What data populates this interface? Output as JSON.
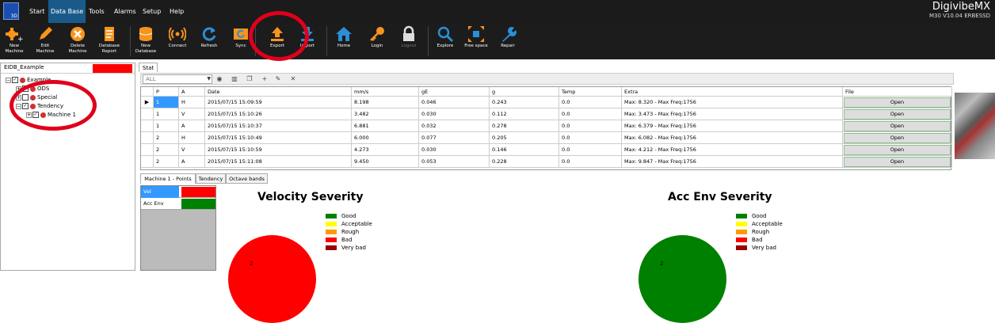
{
  "app": {
    "logo_text": "3D",
    "brand_name": "DigivibeMX",
    "brand_sub": "M30 V10.04",
    "brand_tag": "ERBESSD"
  },
  "menu": [
    "Start",
    "Data Base",
    "Tools",
    "Alarms",
    "Setup",
    "Help"
  ],
  "ribbon": [
    {
      "label": "New Machine",
      "icon": "new-machine-icon",
      "enabled": true
    },
    {
      "label": "Edit Machine",
      "icon": "pencil-icon",
      "enabled": true
    },
    {
      "label": "Delete Machine",
      "icon": "delete-icon",
      "enabled": true
    },
    {
      "label": "Database Report",
      "icon": "report-icon",
      "enabled": true
    },
    {
      "label": "New Database",
      "icon": "database-icon",
      "enabled": true
    },
    {
      "label": "Connect",
      "icon": "connect-icon",
      "enabled": true
    },
    {
      "label": "Refresh",
      "icon": "refresh-icon",
      "enabled": true
    },
    {
      "label": "Sync",
      "icon": "sync-icon",
      "enabled": true
    },
    {
      "label": "Export",
      "icon": "export-icon",
      "enabled": true
    },
    {
      "label": "Import",
      "icon": "import-icon",
      "enabled": true
    },
    {
      "label": "Home",
      "icon": "home-icon",
      "enabled": true
    },
    {
      "label": "Login",
      "icon": "key-icon",
      "enabled": true
    },
    {
      "label": "Logout",
      "icon": "lock-icon",
      "enabled": false
    },
    {
      "label": "Explore",
      "icon": "search-icon",
      "enabled": true
    },
    {
      "label": "Free space",
      "icon": "free-space-icon",
      "enabled": true
    },
    {
      "label": "Repair",
      "icon": "wrench-icon",
      "enabled": true
    }
  ],
  "tree": {
    "db_name": "EIDB_Example",
    "nodes": [
      "Example",
      "ODS",
      "Special",
      "Tendency",
      "Machine 1"
    ]
  },
  "stat_tab": "Stat",
  "toolbar": {
    "filter_value": "ALL"
  },
  "table": {
    "columns": [
      "P",
      "A",
      "Date",
      "mm/s",
      "gE",
      "g",
      "Temp",
      "Extra",
      "File"
    ],
    "rows": [
      [
        "1",
        "H",
        "2015/07/15 15:09:59",
        "8.198",
        "0.046",
        "0.243",
        "0.0",
        "Max: 8.320 - Max Freq:1756",
        "Open"
      ],
      [
        "1",
        "V",
        "2015/07/15 15:10:26",
        "3.482",
        "0.030",
        "0.112",
        "0.0",
        "Max: 3.473 - Max Freq:1756",
        "Open"
      ],
      [
        "1",
        "A",
        "2015/07/15 15:10:37",
        "6.881",
        "0.032",
        "0.278",
        "0.0",
        "Max: 6.379 - Max Freq:1756",
        "Open"
      ],
      [
        "2",
        "H",
        "2015/07/15 15:10:49",
        "6.000",
        "0.077",
        "0.205",
        "0.0",
        "Max: 6.082 - Max Freq:1756",
        "Open"
      ],
      [
        "2",
        "V",
        "2015/07/15 15:10:59",
        "4.273",
        "0.030",
        "0.146",
        "0.0",
        "Max: 4.212 - Max Freq:1756",
        "Open"
      ],
      [
        "2",
        "A",
        "2015/07/15 15:11:08",
        "9.450",
        "0.053",
        "0.228",
        "0.0",
        "Max: 9.847 - Max Freq:1756",
        "Open"
      ]
    ]
  },
  "bottom_tabs": [
    "Machine 1 - Points",
    "Tendency",
    "Octave bands"
  ],
  "points_list": [
    {
      "name": "Vel",
      "color": "#ff0000"
    },
    {
      "name": "Acc Env",
      "color": "#008000"
    }
  ],
  "charts": [
    {
      "title": "Velocity Severity",
      "slice_label": "2",
      "color": "#ff0000"
    },
    {
      "title": "Acc Env Severity",
      "slice_label": "2",
      "color": "#008000"
    }
  ],
  "legend": [
    {
      "label": "Good",
      "color": "#008000"
    },
    {
      "label": "Acceptable",
      "color": "#ffff00"
    },
    {
      "label": "Rough",
      "color": "#ff9900"
    },
    {
      "label": "Bad",
      "color": "#ff0000"
    },
    {
      "label": "Very bad",
      "color": "#990000"
    }
  ]
}
